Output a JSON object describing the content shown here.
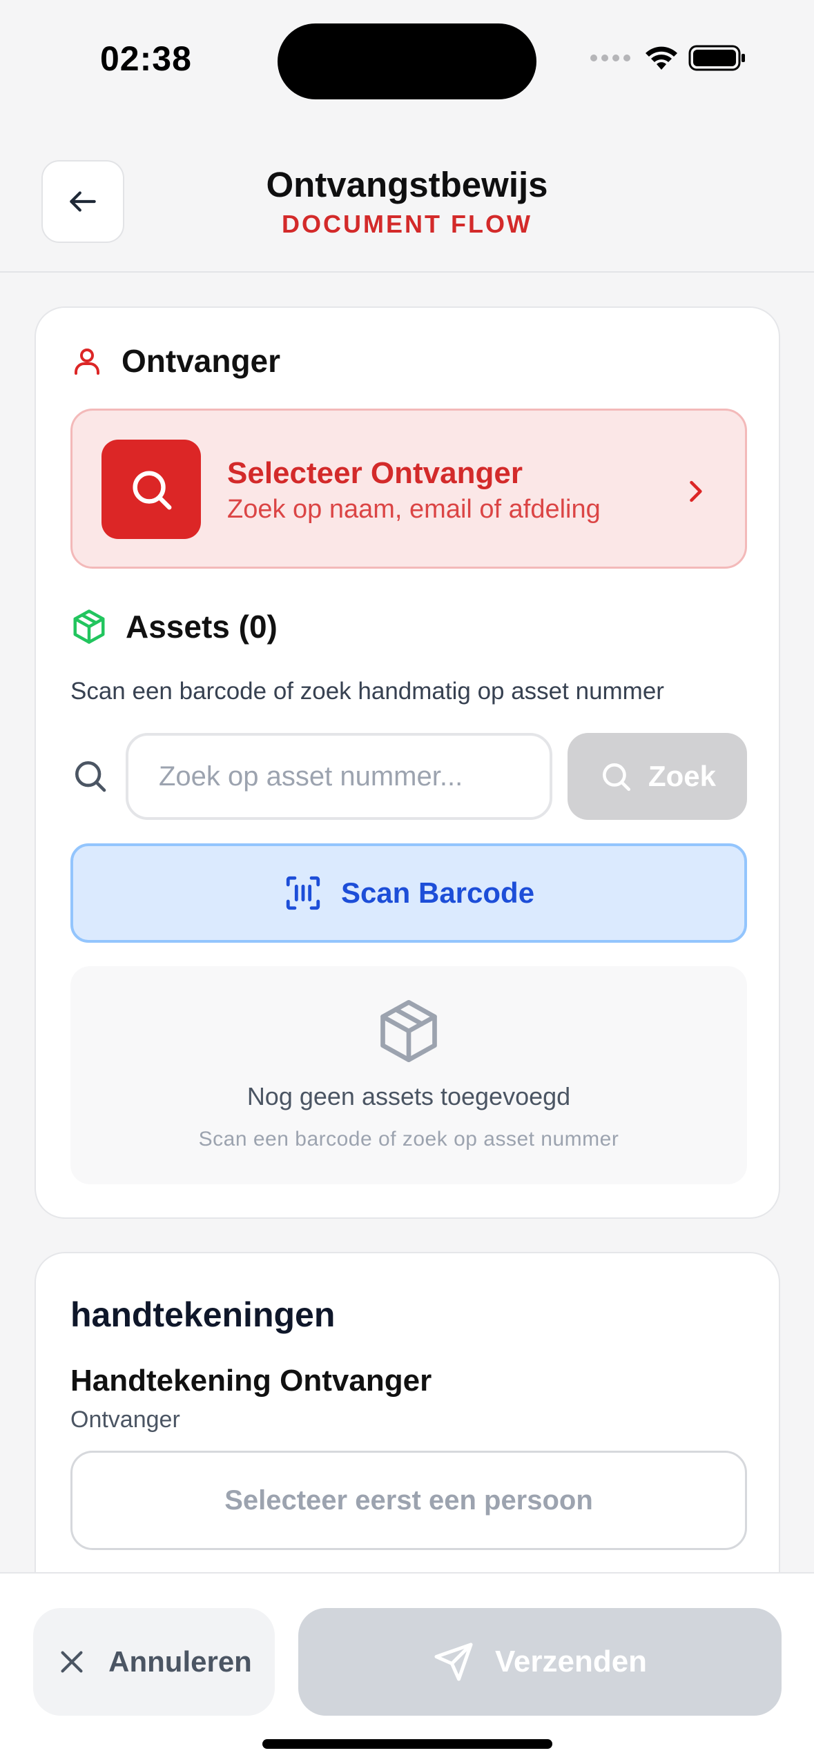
{
  "status_bar": {
    "time": "02:38"
  },
  "header": {
    "title": "Ontvangstbewijs",
    "subtitle": "DOCUMENT FLOW",
    "back_icon": "arrow-left-icon"
  },
  "recipient_section": {
    "label": "Ontvanger",
    "icon": "user-icon",
    "select": {
      "title": "Selecteer Ontvanger",
      "subtitle": "Zoek op naam, email of afdeling"
    }
  },
  "assets_section": {
    "label": "Assets (0)",
    "icon": "package-icon",
    "description": "Scan een barcode of zoek handmatig op asset nummer",
    "search": {
      "placeholder": "Zoek op asset nummer...",
      "value": "",
      "button_label": "Zoek"
    },
    "scan_button_label": "Scan Barcode",
    "empty_state": {
      "title": "Nog geen assets toegevoegd",
      "subtitle": "Scan een barcode of zoek op asset nummer"
    }
  },
  "signatures_section": {
    "label": "handtekeningen",
    "signature": {
      "title": "Handtekening Ontvanger",
      "role": "Ontvanger",
      "button_label": "Selecteer eerst een persoon"
    }
  },
  "footer": {
    "cancel_label": "Annuleren",
    "send_label": "Verzenden"
  },
  "colors": {
    "accent_red": "#dc2626",
    "accent_blue": "#1d4ed8",
    "success_green": "#22c55e",
    "disabled_gray": "#d1d5db"
  }
}
